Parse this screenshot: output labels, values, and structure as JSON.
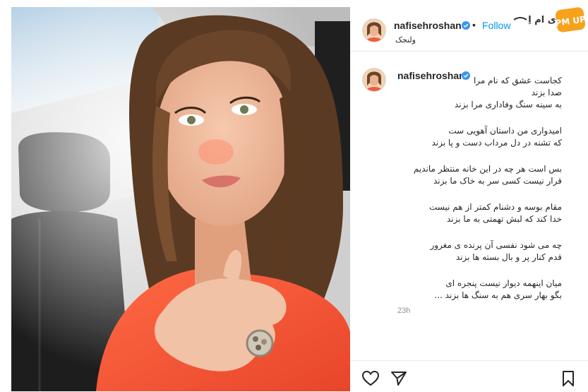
{
  "post": {
    "username": "nafisehroshan",
    "separator": "•",
    "follow_label": "Follow",
    "location": "ولنجک",
    "caption_username": "nafisehroshan",
    "caption_lines": [
      "کجاست عشق که نام مرا",
      "صدا بزند",
      "به سینه سنگ وفاداری مرا بزند",
      "امیدواری من داستان آهویی ست",
      "که تشنه در دل مرداب دست و پا بزند",
      "بس است هر چه در این خانه منتظر ماندیم",
      "قرار نیست کسی سر به خاک ما بزند",
      "مقام بوسه و دشنام کمتر از هم نیست",
      "خدا کند که لبش تهمتی به ما بزند",
      "چه می شود نفسی آن پرنده ی مغرور",
      "قدم کنار پر و بال بسته ها بزند",
      "میان اینهمه دیوار نیست پنجره ای",
      "بگو بهار سری هم به سنگ ها بزند ..."
    ],
    "timestamp": "23h"
  },
  "watermark": {
    "text": "ی ام اِ",
    "badge": "PM UP"
  },
  "icons": {
    "verified": "verified-badge-icon",
    "like": "heart-icon",
    "share": "paper-plane-icon",
    "save": "bookmark-icon"
  },
  "colors": {
    "follow": "#0095f6",
    "verified": "#3897f0",
    "text": "#262626",
    "muted": "#8e8e8e",
    "watermark_orange": "#f7a21b"
  }
}
